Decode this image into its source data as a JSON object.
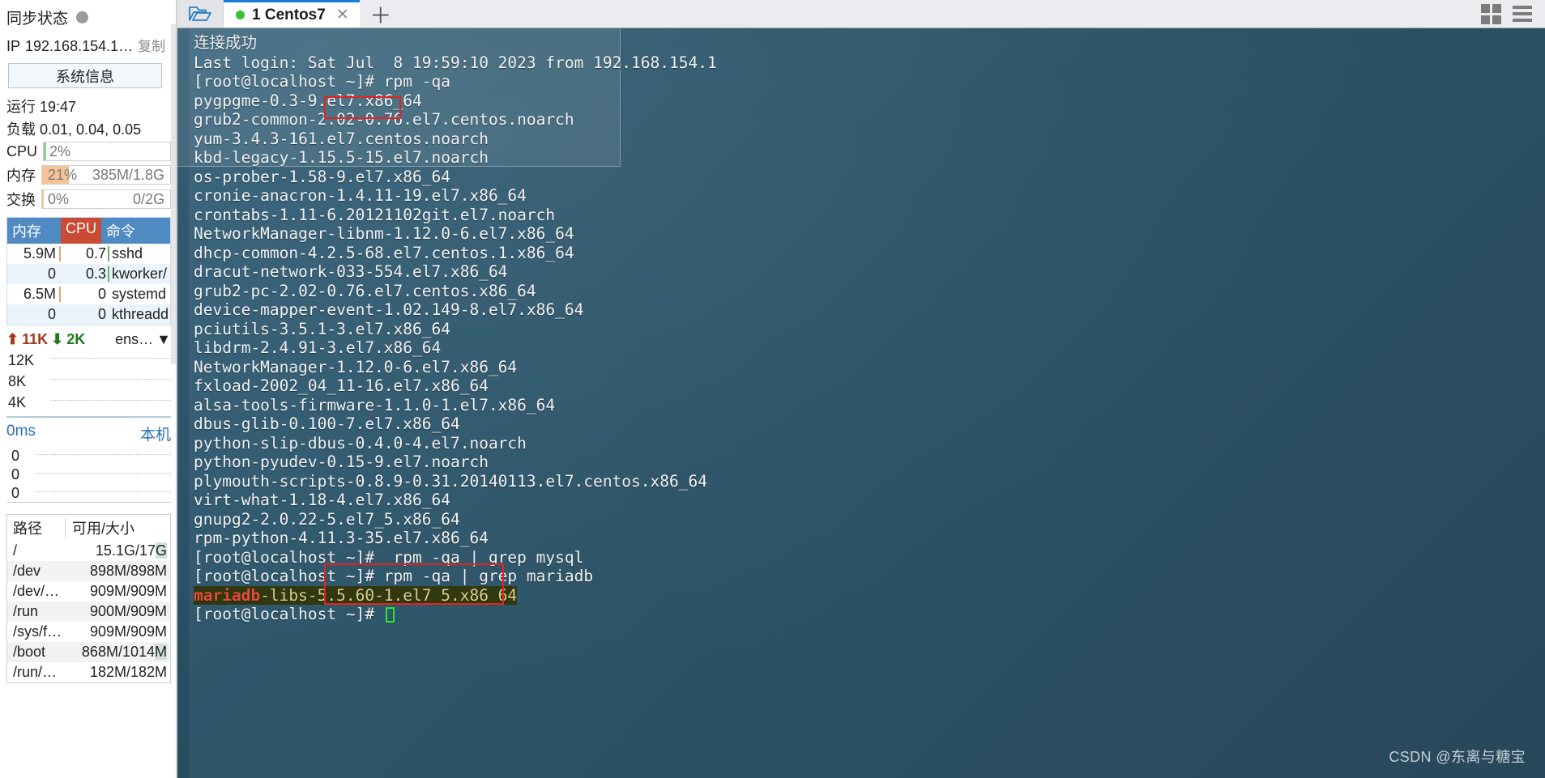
{
  "sidebar": {
    "sync_label": "同步状态",
    "sync_status_icon": "gray-dot",
    "ip_label": "IP",
    "ip_value": "192.168.154.1…",
    "copy_label": "复制",
    "system_info_button": "系统信息",
    "uptime_label": "运行",
    "uptime_value": "19:47",
    "load_label": "负载",
    "load_value": "0.01, 0.04, 0.05",
    "meters": [
      {
        "label": "CPU",
        "pct": "2%",
        "amount": "",
        "fill_pct": 2,
        "fill_color": "#8fd08f"
      },
      {
        "label": "内存",
        "pct": "21%",
        "amount": "385M/1.8G",
        "fill_pct": 21,
        "fill_color": "#f6c396"
      },
      {
        "label": "交换",
        "pct": "0%",
        "amount": "0/2G",
        "fill_pct": 0,
        "fill_color": "#f6c396"
      }
    ],
    "process_table": {
      "headers": [
        "内存",
        "CPU",
        "命令"
      ],
      "rows": [
        {
          "mem": "5.9M",
          "cpu": "0.7",
          "cmd": "sshd",
          "mem_bar": true,
          "cpu_bar": true
        },
        {
          "mem": "0",
          "cpu": "0.3",
          "cmd": "kworker/",
          "mem_bar": false,
          "cpu_bar": true
        },
        {
          "mem": "6.5M",
          "cpu": "0",
          "cmd": "systemd",
          "mem_bar": true,
          "cpu_bar": false
        },
        {
          "mem": "0",
          "cpu": "0",
          "cmd": "kthreadd",
          "mem_bar": false,
          "cpu_bar": false
        }
      ]
    },
    "network": {
      "up_value": "11K",
      "down_value": "2K",
      "interface": "ens…",
      "y_labels": [
        "12K",
        "8K",
        "4K"
      ]
    },
    "latency": {
      "value": "0ms",
      "host_label": "本机",
      "y_labels": [
        "0",
        "0",
        "0"
      ]
    },
    "disk_table": {
      "headers": [
        "路径",
        "可用/大小"
      ],
      "rows": [
        {
          "path": "/",
          "size": "15.1G/17",
          "size_hl": "G"
        },
        {
          "path": "/dev",
          "size": "898M/898M",
          "size_hl": ""
        },
        {
          "path": "/dev/…",
          "size": "909M/909M",
          "size_hl": ""
        },
        {
          "path": "/run",
          "size": "900M/909M",
          "size_hl": ""
        },
        {
          "path": "/sys/f…",
          "size": "909M/909M",
          "size_hl": ""
        },
        {
          "path": "/boot",
          "size": "868M/1014",
          "size_hl": "M"
        },
        {
          "path": "/run/…",
          "size": "182M/182M",
          "size_hl": ""
        }
      ]
    }
  },
  "tabbar": {
    "folder_icon": "open-folder-icon",
    "tab_label": "1 Centos7",
    "tab_status_icon": "green-dot",
    "close_icon": "close-icon",
    "new_tab_icon": "plus-icon",
    "grid_icon": "grid-layout-icon",
    "menu_icon": "hamburger-menu-icon"
  },
  "terminal": {
    "lines": [
      {
        "text": "连接成功",
        "type": "cjk"
      },
      {
        "text": "Last login: Sat Jul  8 19:59:10 2023 from 192.168.154.1",
        "type": "plain"
      },
      {
        "text": "[root@localhost ~]# rpm -qa",
        "type": "plain"
      },
      {
        "text": "pygpgme-0.3-9.el7.x86_64",
        "type": "plain"
      },
      {
        "text": "grub2-common-2.02-0.76.el7.centos.noarch",
        "type": "plain"
      },
      {
        "text": "yum-3.4.3-161.el7.centos.noarch",
        "type": "plain"
      },
      {
        "text": "kbd-legacy-1.15.5-15.el7.noarch",
        "type": "plain"
      },
      {
        "text": "os-prober-1.58-9.el7.x86_64",
        "type": "plain"
      },
      {
        "text": "cronie-anacron-1.4.11-19.el7.x86_64",
        "type": "plain"
      },
      {
        "text": "crontabs-1.11-6.20121102git.el7.noarch",
        "type": "plain"
      },
      {
        "text": "NetworkManager-libnm-1.12.0-6.el7.x86_64",
        "type": "plain"
      },
      {
        "text": "dhcp-common-4.2.5-68.el7.centos.1.x86_64",
        "type": "plain"
      },
      {
        "text": "dracut-network-033-554.el7.x86_64",
        "type": "plain"
      },
      {
        "text": "grub2-pc-2.02-0.76.el7.centos.x86_64",
        "type": "plain"
      },
      {
        "text": "device-mapper-event-1.02.149-8.el7.x86_64",
        "type": "plain"
      },
      {
        "text": "pciutils-3.5.1-3.el7.x86_64",
        "type": "plain"
      },
      {
        "text": "libdrm-2.4.91-3.el7.x86_64",
        "type": "plain"
      },
      {
        "text": "NetworkManager-1.12.0-6.el7.x86_64",
        "type": "plain"
      },
      {
        "text": "fxload-2002_04_11-16.el7.x86_64",
        "type": "plain"
      },
      {
        "text": "alsa-tools-firmware-1.1.0-1.el7.x86_64",
        "type": "plain"
      },
      {
        "text": "dbus-glib-0.100-7.el7.x86_64",
        "type": "plain"
      },
      {
        "text": "python-slip-dbus-0.4.0-4.el7.noarch",
        "type": "plain"
      },
      {
        "text": "python-pyudev-0.15-9.el7.noarch",
        "type": "plain"
      },
      {
        "text": "plymouth-scripts-0.8.9-0.31.20140113.el7.centos.x86_64",
        "type": "plain"
      },
      {
        "text": "virt-what-1.18-4.el7.x86_64",
        "type": "plain"
      },
      {
        "text": "gnupg2-2.0.22-5.el7_5.x86_64",
        "type": "plain"
      },
      {
        "text": "rpm-python-4.11.3-35.el7.x86_64",
        "type": "plain"
      },
      {
        "text": "[root@localhost ~]#  rpm -qa | grep mysql",
        "type": "plain"
      },
      {
        "text": "[root@localhost ~]# rpm -qa | grep mariadb",
        "type": "plain"
      },
      {
        "text": "mariadb-libs-5.5.60-1.el7_5.x86_64",
        "type": "grep-match",
        "match": "mariadb",
        "rest": "-libs-5.5.60-1.el7_5.x86_64"
      },
      {
        "text": "[root@localhost ~]# ",
        "type": "prompt-cursor"
      }
    ],
    "highlight_boxes": [
      {
        "name": "rpm-qa-command-highlight",
        "color": "#e8221a"
      },
      {
        "name": "grep-commands-highlight",
        "color": "#e8221a"
      }
    ]
  },
  "watermark": "CSDN @东离与糖宝",
  "colors": {
    "terminal_bg": "#2d5468",
    "accent_blue": "#1a7fd4",
    "header_blue": "#4f8ac2",
    "header_red": "#c94a35",
    "highlight_red": "#e8221a",
    "grep_match_red": "#e64b3c",
    "net_up": "#f9ceb8",
    "net_down": "#9b9d72"
  }
}
